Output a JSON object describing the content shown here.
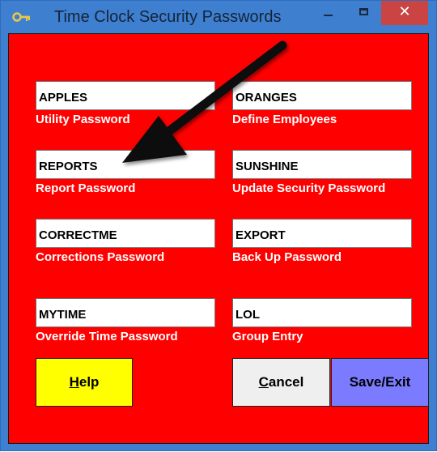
{
  "window": {
    "title": "Time Clock Security Passwords",
    "close_symbol": "✕",
    "colors": {
      "titlebar": "#3f7fcf",
      "client": "#ff0000",
      "close": "#c94443"
    }
  },
  "fields": [
    {
      "value": "APPLES",
      "label": "Utility Password"
    },
    {
      "value": "ORANGES",
      "label": "Define Employees"
    },
    {
      "value": "REPORTS",
      "label": "Report Password"
    },
    {
      "value": "SUNSHINE",
      "label": "Update Security Password"
    },
    {
      "value": "CORRECTME",
      "label": "Corrections Password"
    },
    {
      "value": "EXPORT",
      "label": "Back Up Password"
    },
    {
      "value": "MYTIME",
      "label": "Override Time Password"
    },
    {
      "value": "LOL",
      "label": "Group Entry"
    }
  ],
  "buttons": {
    "help_mnemonic": "H",
    "help_rest": "elp",
    "cancel_mnemonic": "C",
    "cancel_rest": "ancel",
    "save": "Save/Exit",
    "colors": {
      "help": "#ffff00",
      "cancel": "#efefef",
      "save": "#7b7bff"
    }
  },
  "icons": {
    "app": "key-icon",
    "minimize": "minimize-icon",
    "maximize": "maximize-icon",
    "close": "close-icon",
    "annotation": "arrow-annotation"
  }
}
